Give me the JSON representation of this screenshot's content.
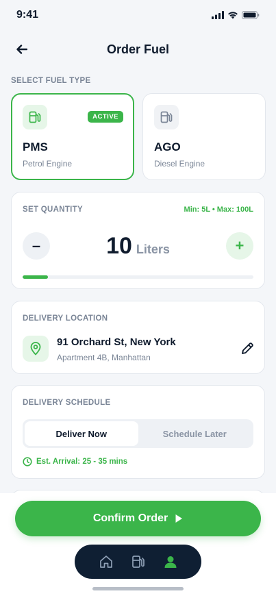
{
  "status_bar": {
    "time": "9:41"
  },
  "header": {
    "title": "Order Fuel"
  },
  "fuel_type": {
    "label": "SELECT FUEL TYPE",
    "options": [
      {
        "code": "PMS",
        "description": "Petrol Engine",
        "badge": "ACTIVE",
        "selected": true
      },
      {
        "code": "AGO",
        "description": "Diesel Engine",
        "selected": false
      }
    ]
  },
  "quantity": {
    "label": "SET QUANTITY",
    "limits": "Min: 5L • Max: 100L",
    "value": "10",
    "unit": "Liters",
    "decrement_symbol": "–",
    "increment_symbol": "+",
    "progress_fraction": 0.11
  },
  "delivery_location": {
    "label": "DELIVERY LOCATION",
    "address": "91 Orchard St, New York",
    "detail": "Apartment 4B, Manhattan"
  },
  "delivery_schedule": {
    "label": "DELIVERY SCHEDULE",
    "options": [
      "Deliver Now",
      "Schedule Later"
    ],
    "selected": "Deliver Now",
    "eta": "Est. Arrival: 25 - 35 mins"
  },
  "confirm": {
    "label": "Confirm Order"
  },
  "nav": {
    "items": [
      "home-icon",
      "fuel-pump-icon",
      "profile-icon"
    ],
    "active": "profile-icon"
  },
  "colors": {
    "accent": "#3BB54A",
    "navy": "#0F1F33",
    "muted": "#7A8596"
  }
}
